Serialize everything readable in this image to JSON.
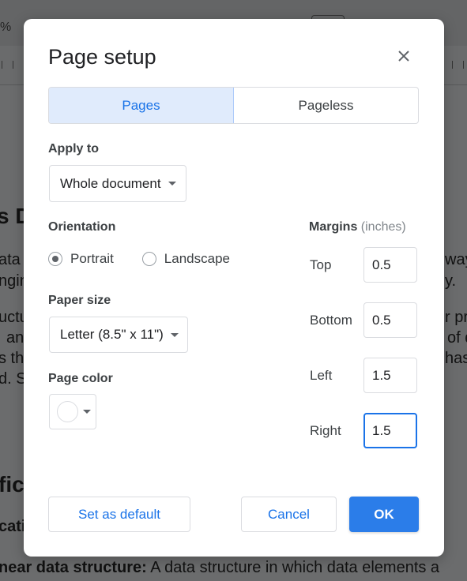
{
  "background": {
    "zoom_fragment": "%",
    "heading_1": "s D",
    "para1_line1": "ata s",
    "para1_line2": "ngin",
    "para2_line1": "uctu",
    "para2_line2": "an",
    "para2_line3": "s tha",
    "para2_line4": "d. S",
    "right1": "way",
    "right2": "y.",
    "right3": "r pro",
    "right4": "of d",
    "right5": "has",
    "heading_2": "fic",
    "subheading": "catio",
    "bottom_bold": "near data structure:",
    "bottom_text": " A data structure in which data elements a"
  },
  "dialog": {
    "title": "Page setup",
    "close_icon": "close-icon",
    "tabs": [
      {
        "label": "Pages",
        "active": true
      },
      {
        "label": "Pageless",
        "active": false
      }
    ],
    "apply_to": {
      "label": "Apply to",
      "value": "Whole document"
    },
    "orientation": {
      "label": "Orientation",
      "options": [
        {
          "label": "Portrait",
          "selected": true
        },
        {
          "label": "Landscape",
          "selected": false
        }
      ]
    },
    "paper_size": {
      "label": "Paper size",
      "value": "Letter (8.5\" x 11\")"
    },
    "page_color": {
      "label": "Page color",
      "value": "#ffffff"
    },
    "margins": {
      "title": "Margins",
      "unit": "(inches)",
      "fields": [
        {
          "label": "Top",
          "value": "0.5"
        },
        {
          "label": "Bottom",
          "value": "0.5"
        },
        {
          "label": "Left",
          "value": "1.5"
        },
        {
          "label": "Right",
          "value": "1.5",
          "focused": true
        }
      ]
    },
    "buttons": {
      "set_default": "Set as default",
      "cancel": "Cancel",
      "ok": "OK"
    },
    "colors": {
      "accent": "#1a73e8",
      "primary_button": "#2b7de9",
      "active_tab_bg": "#e0ebfc"
    }
  }
}
